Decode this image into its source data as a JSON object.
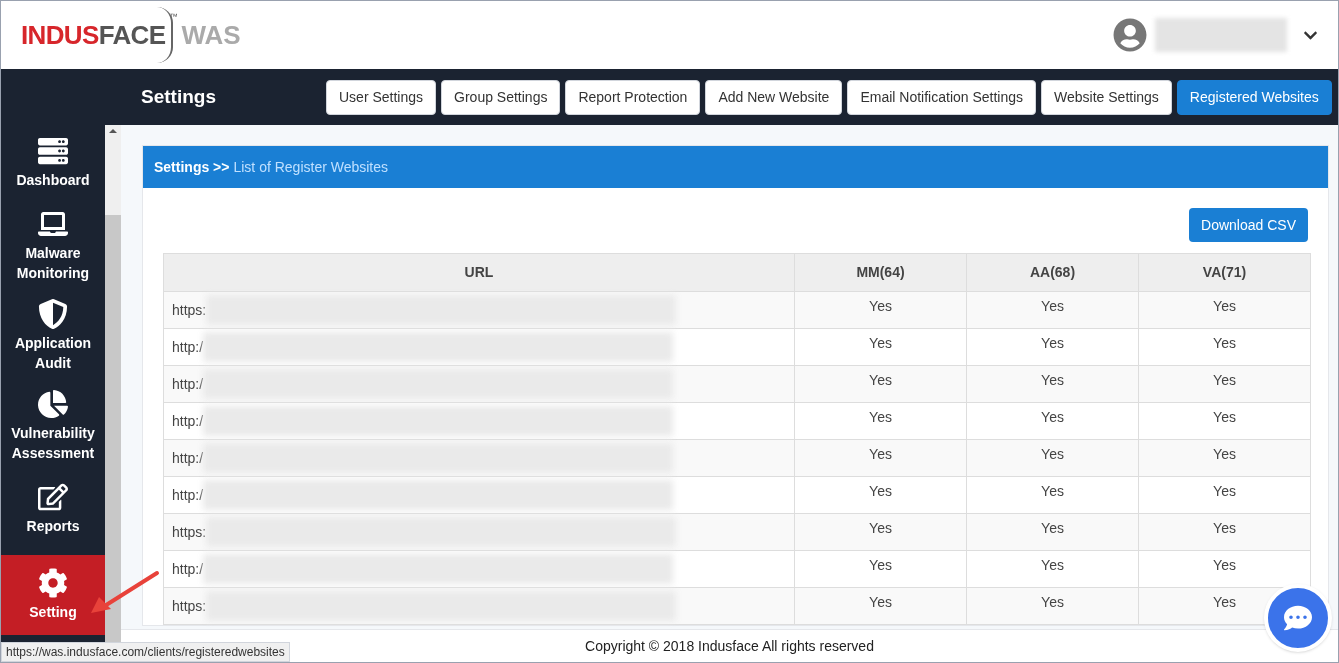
{
  "logo": {
    "brand_part_1": "INDUS",
    "brand_part_2": "FACE",
    "trademark": "™",
    "product": "WAS"
  },
  "page_title": "Settings",
  "tabs": [
    {
      "label": "User Settings",
      "selected": false
    },
    {
      "label": "Group Settings",
      "selected": false
    },
    {
      "label": "Report Protection",
      "selected": false
    },
    {
      "label": "Add New Website",
      "selected": false
    },
    {
      "label": "Email Notification Settings",
      "selected": false
    },
    {
      "label": "Website Settings",
      "selected": false
    },
    {
      "label": "Registered Websites",
      "selected": true
    }
  ],
  "sidebar": {
    "items": [
      {
        "label": "Dashboard",
        "selected": false
      },
      {
        "label": "Malware Monitoring",
        "selected": false
      },
      {
        "label": "Application Audit",
        "selected": false
      },
      {
        "label": "Vulnerability Assessment",
        "selected": false
      },
      {
        "label": "Reports",
        "selected": false
      },
      {
        "label": "Setting",
        "selected": true
      }
    ]
  },
  "breadcrumb": {
    "root": "Settings >>",
    "current": "List of Register Websites"
  },
  "download_button": "Download CSV",
  "table": {
    "columns": [
      "URL",
      "MM(64)",
      "AA(68)",
      "VA(71)"
    ],
    "rows": [
      {
        "url": "https:",
        "mm": "Yes",
        "aa": "Yes",
        "va": "Yes"
      },
      {
        "url": "http:/",
        "mm": "Yes",
        "aa": "Yes",
        "va": "Yes"
      },
      {
        "url": "http:/",
        "mm": "Yes",
        "aa": "Yes",
        "va": "Yes"
      },
      {
        "url": "http:/",
        "mm": "Yes",
        "aa": "Yes",
        "va": "Yes"
      },
      {
        "url": "http:/",
        "mm": "Yes",
        "aa": "Yes",
        "va": "Yes"
      },
      {
        "url": "http:/",
        "mm": "Yes",
        "aa": "Yes",
        "va": "Yes"
      },
      {
        "url": "https:",
        "mm": "Yes",
        "aa": "Yes",
        "va": "Yes"
      },
      {
        "url": "http:/",
        "mm": "Yes",
        "aa": "Yes",
        "va": "Yes"
      },
      {
        "url": "https:",
        "mm": "Yes",
        "aa": "Yes",
        "va": "Yes"
      }
    ]
  },
  "footer": "Copyright © 2018 Indusface All rights reserved",
  "status_bar": "https://was.indusface.com/clients/registeredwebsites"
}
